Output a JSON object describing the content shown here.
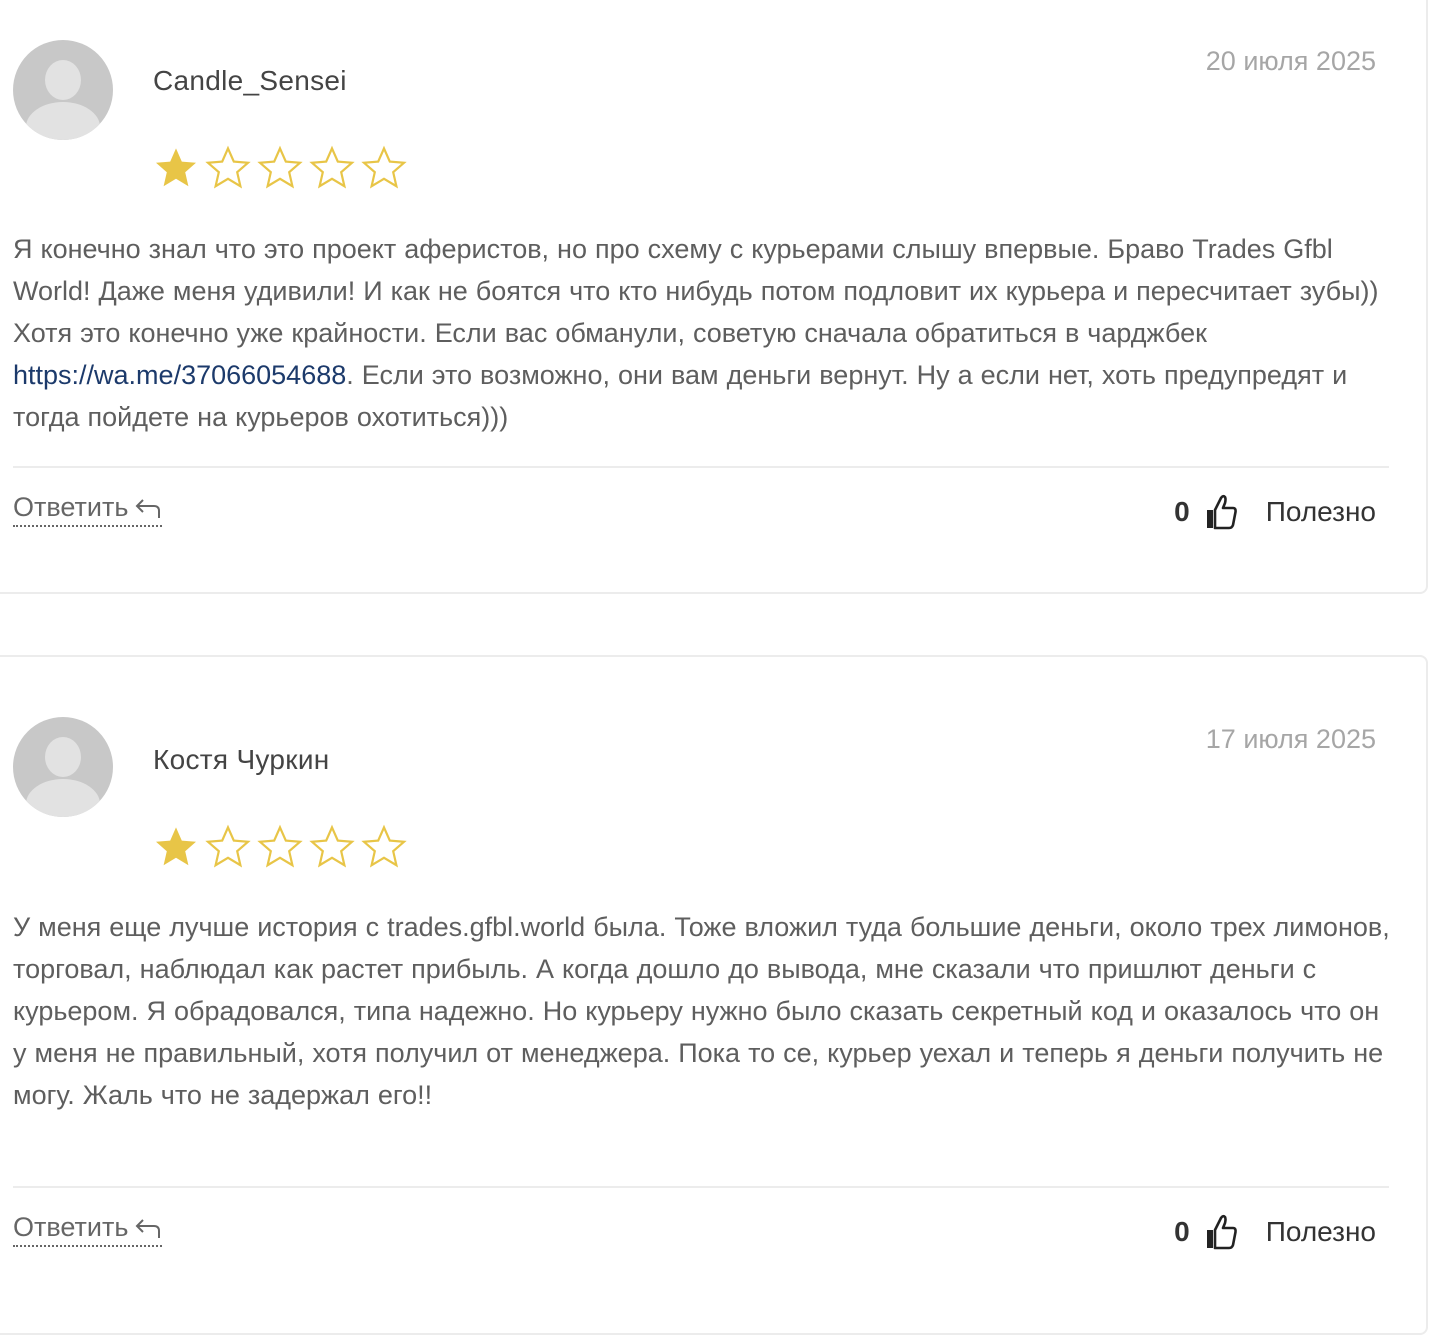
{
  "reviews": [
    {
      "author": "Candle_Sensei",
      "date": "20 июля 2025",
      "rating": 1,
      "max_rating": 5,
      "text_before_link": "Я конечно знал что это проект аферистов, но про схему с курьерами слышу впервые. Браво Trades Gfbl World! Даже меня удивили! И как не боятся что кто нибудь потом подловит их курьера и пересчитает зубы)) Хотя это конечно уже крайности. Если вас обманули, советую сначала обратиться в чарджбек ",
      "link": "https://wa.me/37066054688",
      "text_after_link": ". Если это возможно, они вам деньги вернут. Ну а если нет, хоть предупредят и тогда пойдете на курьеров охотиться)))",
      "reply_label": "Ответить",
      "helpful_count": "0",
      "helpful_label": "Полезно"
    },
    {
      "author": "Костя Чуркин",
      "date": "17 июля 2025",
      "rating": 1,
      "max_rating": 5,
      "text_before_link": "У меня еще лучше история с trades.gfbl.world была. Тоже вложил туда большие деньги, около трех лимонов, торговал, наблюдал как растет прибыль. А когда дошло до вывода, мне сказали что пришлют деньги с курьером. Я обрадовался, типа надежно. Но курьеру нужно было сказать секретный код и оказалось что он у меня не правильный, хотя получил от менеджера. Пока то се, курьер уехал и теперь я деньги получить не могу. Жаль что не задержал его!!",
      "link": "",
      "text_after_link": "",
      "reply_label": "Ответить",
      "helpful_count": "0",
      "helpful_label": "Полезно"
    }
  ],
  "colors": {
    "star_filled": "#e8c547",
    "star_outline": "#e8c547",
    "link": "#1c3a6b",
    "date": "#a6a6a6",
    "border": "#ececec"
  },
  "icons": {
    "avatar": "default-user-avatar",
    "star": "star-icon",
    "reply": "reply-arrow-icon",
    "helpful": "thumbs-up-icon"
  }
}
